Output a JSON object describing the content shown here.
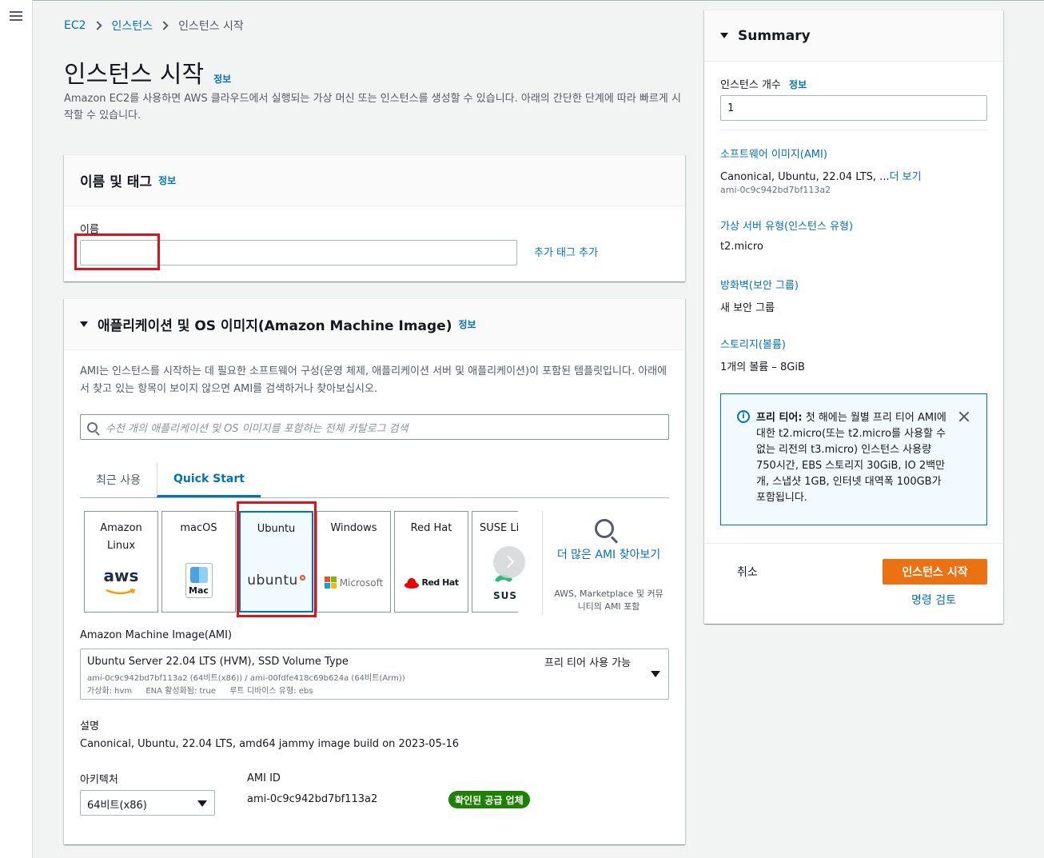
{
  "breadcrumb": [
    "EC2",
    "인스턴스",
    "인스턴스 시작"
  ],
  "page": {
    "title": "인스턴스 시작",
    "info": "정보",
    "description": "Amazon EC2를 사용하면 AWS 클라우드에서 실행되는 가상 머신 또는 인스턴스를 생성할 수 있습니다. 아래의 간단한 단계에 따라 빠르게 시작할 수 있습니다."
  },
  "name_section": {
    "title": "이름 및 태그",
    "info": "정보",
    "name_label": "이름",
    "name_value": "",
    "add_tag_link": "추가 태그 추가"
  },
  "ami_section": {
    "title": "애플리케이션 및 OS 이미지(Amazon Machine Image)",
    "info": "정보",
    "description": "AMI는 인스턴스를 시작하는 데 필요한 소프트웨어 구성(운영 체제, 애플리케이션 서버 및 애플리케이션)이 포함된 템플릿입니다. 아래에서 찾고 있는 항목이 보이지 않으면 AMI를 검색하거나 찾아보십시오.",
    "search_placeholder": "수천 개의 애플리케이션 및 OS 이미지를 포함하는 전체 카탈로그 검색",
    "tabs": [
      "최근 사용",
      "Quick Start"
    ],
    "active_tab": "Quick Start",
    "os_cards": [
      {
        "label": "Amazon Linux",
        "logo_text": "aws"
      },
      {
        "label": "macOS",
        "logo_text": "Mac"
      },
      {
        "label": "Ubuntu",
        "logo_text": "ubuntu"
      },
      {
        "label": "Windows",
        "logo_text": "Microsoft"
      },
      {
        "label": "Red Hat",
        "logo_text": "Red Hat"
      },
      {
        "label": "SUSE Li",
        "logo_text": "SUS"
      }
    ],
    "selected_os": "Ubuntu",
    "more_ami_link": "더 많은 AMI 찾아보기",
    "more_ami_note": "AWS, Marketplace 및 커뮤니티의 AMI 포함",
    "ami_label": "Amazon Machine Image(AMI)",
    "ami_select": {
      "title": "Ubuntu Server 22.04 LTS (HVM), SSD Volume Type",
      "free_tier": "프리 티어 사용 가능",
      "ids": "ami-0c9c942bd7bf113a2 (64비트(x86)) / ami-00fdfe418c69b624a (64비트(Arm))",
      "virt": "가상화: hvm",
      "ena": "ENA 활성화됨: true",
      "root_device": "루트 디바이스 유형: ebs"
    },
    "desc_label": "설명",
    "desc_value": "Canonical, Ubuntu, 22.04 LTS, amd64 jammy image build on 2023-05-16",
    "arch_label": "아키텍처",
    "arch_value": "64비트(x86)",
    "ami_id_label": "AMI ID",
    "ami_id_value": "ami-0c9c942bd7bf113a2",
    "verified_badge": "확인된 공급 업체"
  },
  "summary": {
    "title": "Summary",
    "instance_count_label": "인스턴스 개수",
    "info": "정보",
    "instance_count_value": "1",
    "ami_link": "소프트웨어 이미지(AMI)",
    "ami_value": "Canonical, Ubuntu, 22.04 LTS, ...",
    "ami_more": "더 보기",
    "ami_id": "ami-0c9c942bd7bf113a2",
    "instance_type_link": "가상 서버 유형(인스턴스 유형)",
    "instance_type_value": "t2.micro",
    "firewall_link": "방화벽(보안 그룹)",
    "firewall_value": "새 보안 그룹",
    "storage_link": "스토리지(볼륨)",
    "storage_value": "1개의 볼륨 – 8GiB",
    "free_tier_title": "프리 티어:",
    "free_tier_text": "첫 해에는 월별 프리 티어 AMI에 대한 t2.micro(또는 t2.micro를 사용할 수 없는 리전의 t3.micro) 인스턴스 사용량 750시간, EBS 스토리지 30GiB, IO 2백만 개, 스냅샷 1GB, 인터넷 대역폭 100GB가 포함됩니다.",
    "cancel": "취소",
    "launch": "인스턴스 시작",
    "review": "명령 검토"
  },
  "colors": {
    "link": "#0073bb",
    "primary_button": "#ec7211",
    "highlight_box": "#e0111c",
    "badge": "#1d8102"
  }
}
